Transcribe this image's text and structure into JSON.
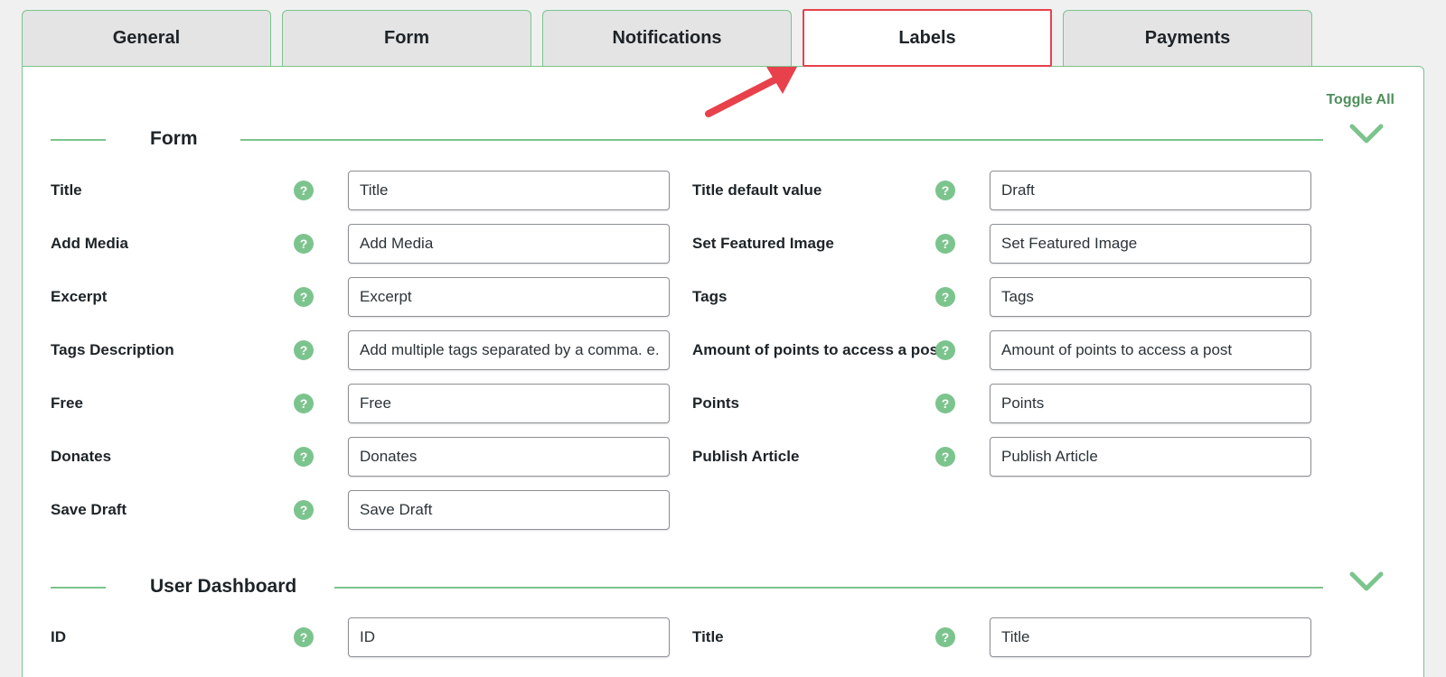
{
  "tabs": [
    {
      "label": "General"
    },
    {
      "label": "Form"
    },
    {
      "label": "Notifications"
    },
    {
      "label": "Labels",
      "active": true
    },
    {
      "label": "Payments"
    }
  ],
  "toggle_all_label": "Toggle All",
  "sections": {
    "form": {
      "title": "Form",
      "left": [
        {
          "label": "Title",
          "value": "Title"
        },
        {
          "label": "Add Media",
          "value": "Add Media"
        },
        {
          "label": "Excerpt",
          "value": "Excerpt"
        },
        {
          "label": "Tags Description",
          "value": "Add multiple tags separated by a comma. e.g."
        },
        {
          "label": "Free",
          "value": "Free"
        },
        {
          "label": "Donates",
          "value": "Donates"
        },
        {
          "label": "Save Draft",
          "value": "Save Draft"
        }
      ],
      "right": [
        {
          "label": "Title default value",
          "value": "Draft"
        },
        {
          "label": "Set Featured Image",
          "value": "Set Featured Image"
        },
        {
          "label": "Tags",
          "value": "Tags"
        },
        {
          "label": "Amount of points to access a post",
          "value": "Amount of points to access a post"
        },
        {
          "label": "Points",
          "value": "Points"
        },
        {
          "label": "Publish Article",
          "value": "Publish Article"
        }
      ]
    },
    "user_dashboard": {
      "title": "User Dashboard",
      "left": [
        {
          "label": "ID",
          "value": "ID"
        }
      ],
      "right": [
        {
          "label": "Title",
          "value": "Title"
        }
      ]
    }
  },
  "help_glyph": "?",
  "colors": {
    "accent_green": "#7cc48d",
    "toggle_green": "#4f8f5b",
    "highlight_red": "#e8414b",
    "tab_inactive_bg": "#e4e4e4"
  }
}
